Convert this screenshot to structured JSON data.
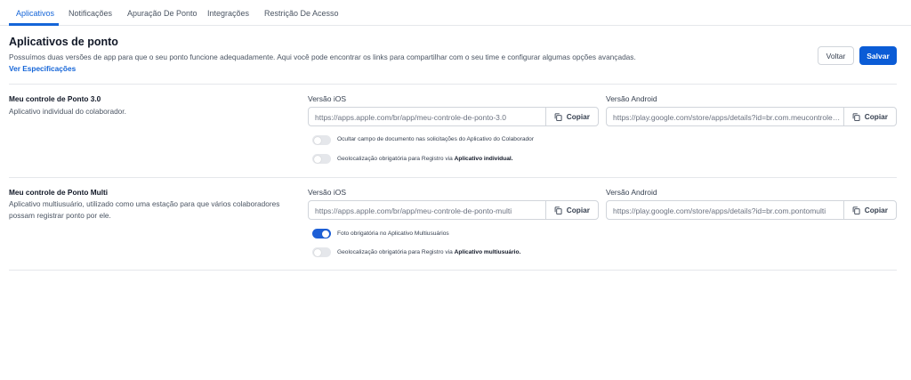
{
  "tabs": [
    {
      "label": "Aplicativos",
      "active": true
    },
    {
      "label": "Notificações"
    },
    {
      "label": "Apuração De Ponto"
    },
    {
      "label": "Integrações"
    },
    {
      "label": "Restrição De Acesso"
    }
  ],
  "header": {
    "title": "Aplicativos de ponto",
    "description": "Possuímos duas versões de app para que o seu ponto funcione adequadamente. Aqui você pode encontrar os links para compartilhar com o seu time e configurar algumas opções avançadas.",
    "spec_link": "Ver Especificações",
    "back_label": "Voltar",
    "save_label": "Salvar"
  },
  "apps": [
    {
      "title": "Meu controle de Ponto 3.0",
      "description": "Aplicativo individual do colaborador.",
      "ios_label": "Versão iOS",
      "ios_url": "https://apps.apple.com/br/app/meu-controle-de-ponto-3.0",
      "android_label": "Versão Android",
      "android_url": "https://play.google.com/store/apps/details?id=br.com.meucontroledeponto",
      "copy_label": "Copiar",
      "toggles": [
        {
          "on": false,
          "label": "Ocultar campo de documento nas solicitações do Aplicativo do Colaborador",
          "bold": ""
        },
        {
          "on": false,
          "label": "Geolocalização obrigatória para Registro via ",
          "bold": "Aplicativo individual."
        }
      ]
    },
    {
      "title": "Meu controle de Ponto Multi",
      "description": "Aplicativo multiusuário, utilizado como uma estação para que vários colaboradores possam registrar ponto por ele.",
      "ios_label": "Versão iOS",
      "ios_url": "https://apps.apple.com/br/app/meu-controle-de-ponto-multi",
      "android_label": "Versão Android",
      "android_url": "https://play.google.com/store/apps/details?id=br.com.pontomulti",
      "copy_label": "Copiar",
      "toggles": [
        {
          "on": true,
          "label": "Foto obrigatória no Aplicativo Multiusuários",
          "bold": ""
        },
        {
          "on": false,
          "label": "Geolocalização obrigatória para Registro via ",
          "bold": "Aplicativo multiusuário."
        }
      ]
    }
  ],
  "colors": {
    "accent": "#1565d8",
    "save_button": "#0b5cd6",
    "toggle_on": "#1d5fd6",
    "toggle_off": "#e5e7eb"
  }
}
